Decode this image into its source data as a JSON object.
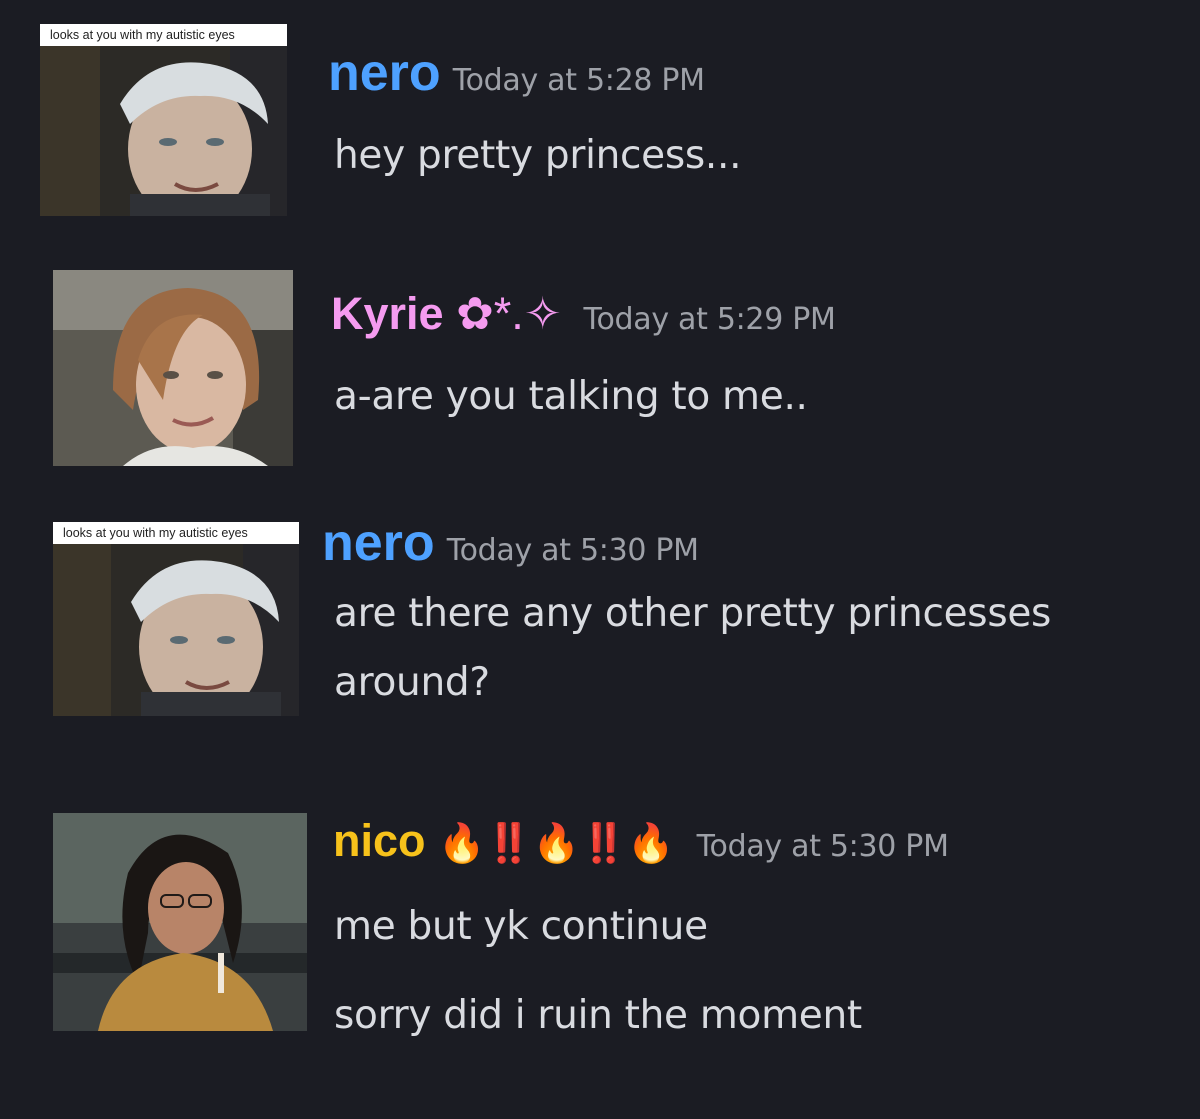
{
  "messages": [
    {
      "author": "nero",
      "author_color": "#4ea1ff",
      "timestamp": "Today at 5:28 PM",
      "avatar_caption": "looks at you with my autistic eyes",
      "lines": [
        "hey pretty princess..."
      ]
    },
    {
      "author": "Kyrie",
      "author_flair": "✿*.✧",
      "author_color": "#f59bf0",
      "timestamp": "Today at 5:29 PM",
      "lines": [
        "a-are you talking to me.."
      ]
    },
    {
      "author": "nero",
      "author_color": "#4ea1ff",
      "timestamp": "Today at 5:30 PM",
      "avatar_caption": "looks at you with my autistic eyes",
      "lines": [
        "are there any other pretty princesses",
        "around?"
      ]
    },
    {
      "author": "nico",
      "author_flair": "🔥‼️🔥‼️🔥",
      "author_color": "#f7c21b",
      "timestamp": "Today at 5:30 PM",
      "lines": [
        "me but yk continue",
        "sorry did i ruin the moment"
      ]
    }
  ]
}
